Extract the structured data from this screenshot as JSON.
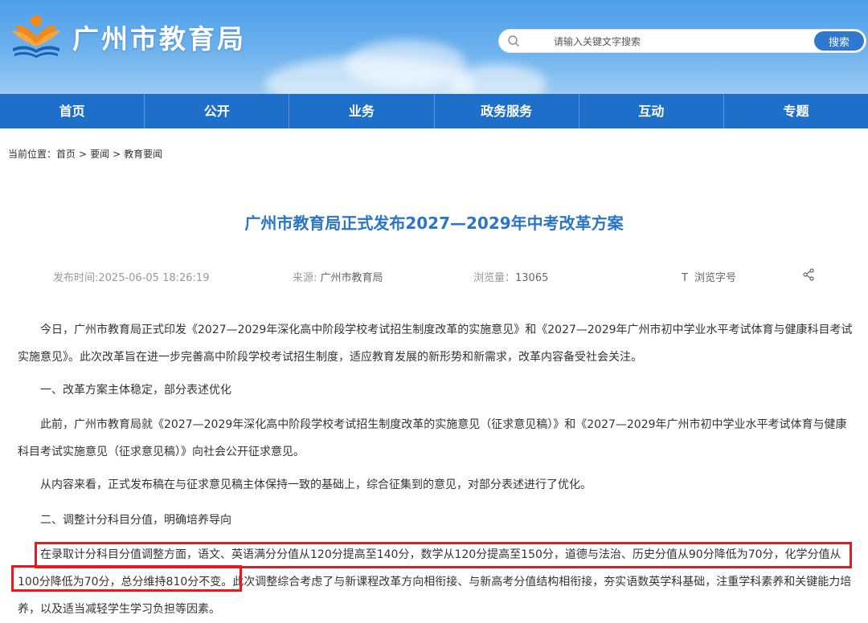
{
  "header": {
    "site_title": "广州市教育局",
    "search_placeholder": "请输入关键文字搜索",
    "search_button": "搜索",
    "colors": {
      "banner": "#5ea6ec",
      "nav": "#1e6fc9",
      "accent": "#2f77cf",
      "logo_orange": "#f08a1c"
    }
  },
  "nav": {
    "items": [
      "首页",
      "公开",
      "业务",
      "政务服务",
      "互动",
      "专题"
    ]
  },
  "breadcrumb": {
    "label": "当前位置：",
    "items": [
      "首页",
      "要闻",
      "教育要闻"
    ],
    "separator": ">"
  },
  "article": {
    "title": "广州市教育局正式发布2027—2029年中考改革方案",
    "meta": {
      "publish_label": "发布时间:",
      "publish_time": "2025-06-05 18:26:19",
      "source_label": "来源:",
      "source": "广州市教育局",
      "views_label": "浏览量：",
      "views": "13065",
      "font_size_icon": "T",
      "font_size_label": "浏览字号",
      "share_icon": "share-icon"
    },
    "paragraphs": [
      "今日，广州市教育局正式印发《2027—2029年深化高中阶段学校考试招生制度改革的实施意见》和《2027—2029年广州市初中学业水平考试体育与健康科目考试实施意见》。此次改革旨在进一步完善高中阶段学校考试招生制度，适应教育发展的新形势和新需求，改革内容备受社会关注。",
      "一、改革方案主体稳定，部分表述优化",
      "此前，广州市教育局就《2027—2029年深化高中阶段学校考试招生制度改革的实施意见（征求意见稿）》和《2027—2029年广州市初中学业水平考试体育与健康科目考试实施意见（征求意见稿）》向社会公开征求意见。",
      "从内容来看，正式发布稿在与征求意见稿主体保持一致的基础上，综合征集到的意见，对部分表述进行了优化。",
      "二、调整计分科目分值，明确培养导向"
    ],
    "highlight_text": "在录取计分科目分值调整方面，语文、英语满分分值从120分提高至140分，数学从120分提高至150分，道德与法治、历史分值从90分降低为70分，化学分值从100分降低为70分，总分维持810分不变。",
    "after_highlight": "此次调整综合考虑了与新课程改革方向相衔接、与新高考分值结构相衔接，夯实语数英学科基础，注重学科素养和关键能力培养，以及适当减轻学生学习负担等因素。"
  }
}
